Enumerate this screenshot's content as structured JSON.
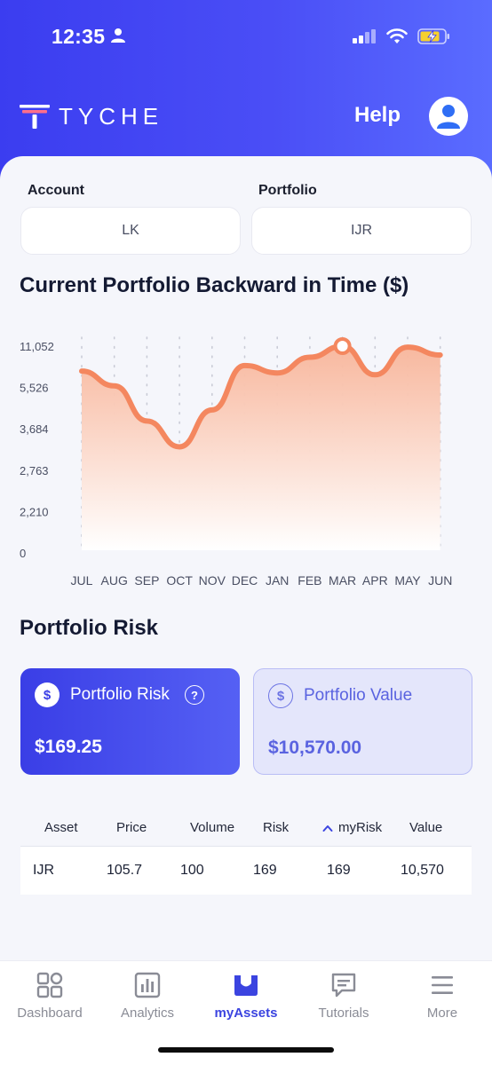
{
  "status_bar": {
    "time": "12:35"
  },
  "header": {
    "brand": "TYCHE",
    "help_label": "Help"
  },
  "filters": {
    "account_label": "Account",
    "account_value": "LK",
    "portfolio_label": "Portfolio",
    "portfolio_value": "IJR"
  },
  "chart_section": {
    "title": "Current Portfolio Backward in Time ($)"
  },
  "chart_data": {
    "type": "area",
    "categories": [
      "JUL",
      "AUG",
      "SEP",
      "OCT",
      "NOV",
      "DEC",
      "JAN",
      "FEB",
      "MAR",
      "APR",
      "MAY",
      "JUN"
    ],
    "y_tick_labels": [
      "11,052",
      "5,526",
      "3,684",
      "2,763",
      "2,210",
      "0"
    ],
    "values": [
      9700,
      8900,
      7000,
      5600,
      7600,
      10000,
      9600,
      10450,
      11052,
      9500,
      11000,
      10570
    ],
    "highlighted_category": "MAR",
    "colors": {
      "line": "#f4875f",
      "fill_top": "#f8b59a",
      "fill_bottom": "#ffffff"
    },
    "grid": "dotted-vertical"
  },
  "risk_section": {
    "title": "Portfolio Risk",
    "cards": [
      {
        "title": "Portfolio Risk",
        "value": "$169.25",
        "icon": "dollar-icon",
        "help": "?"
      },
      {
        "title": "Portfolio Value",
        "value": "$10,570.00",
        "icon": "dollar-icon"
      }
    ]
  },
  "table": {
    "columns": [
      "Asset",
      "Price",
      "Volume",
      "Risk",
      "myRisk",
      "Value"
    ],
    "sort_column": "myRisk",
    "rows": [
      [
        "IJR",
        "105.7",
        "100",
        "169",
        "169",
        "10,570"
      ]
    ]
  },
  "bottom_nav": {
    "items": [
      {
        "label": "Dashboard",
        "icon": "grid-icon"
      },
      {
        "label": "Analytics",
        "icon": "bar-chart-icon"
      },
      {
        "label": "myAssets",
        "icon": "inbox-tray-icon",
        "active": true
      },
      {
        "label": "Tutorials",
        "icon": "message-icon"
      },
      {
        "label": "More",
        "icon": "menu-icon"
      }
    ]
  },
  "colors": {
    "brand_blue": "#3b3df0",
    "accent": "#3b44e0",
    "chart_line": "#f4875f"
  }
}
